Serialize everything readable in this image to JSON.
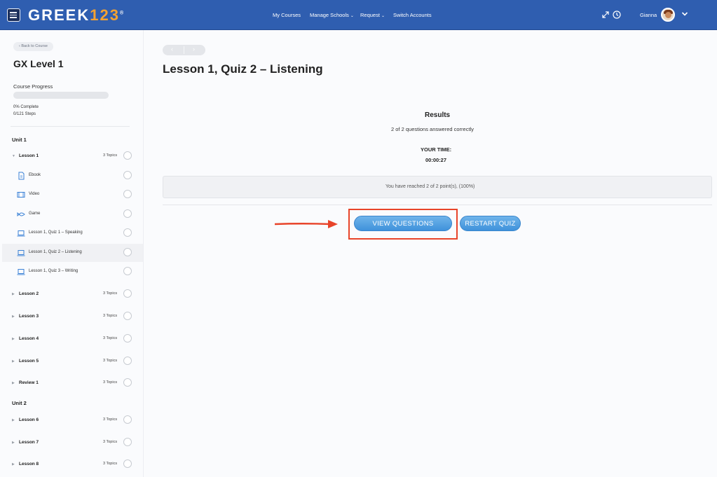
{
  "header": {
    "logo_main": "GREEK",
    "logo_accent": "123",
    "logo_reg": "®",
    "nav": {
      "my_courses": "My Courses",
      "manage_schools": "Manage Schools",
      "request": "Request",
      "switch_accounts": "Switch Accounts"
    },
    "user_name": "Gianna",
    "icons": [
      "menu-icon",
      "expand-icon",
      "clock-icon",
      "chevron-down-icon"
    ],
    "brand_color": "#2f5eb0",
    "accent_color": "#f3a232"
  },
  "sidebar": {
    "back_label": "‹  Back to Course",
    "course_title": "GX Level 1",
    "progress_label": "Course Progress",
    "progress_fraction": 0,
    "progress_pct_text": "0% Complete",
    "progress_steps_text": "0/121 Steps",
    "units": [
      {
        "label": "Unit 1",
        "lessons": [
          {
            "label": "Lesson 1",
            "topics": "3 Topics",
            "expanded": true,
            "items": [
              {
                "label": "Ebook",
                "icon": "ebook-icon"
              },
              {
                "label": "Video",
                "icon": "video-icon"
              },
              {
                "label": "Game",
                "icon": "game-icon"
              },
              {
                "label": "Lesson 1, Quiz 1 – Speaking",
                "icon": "laptop-icon"
              },
              {
                "label": "Lesson 1, Quiz 2 – Listening",
                "icon": "laptop-icon",
                "active": true
              },
              {
                "label": "Lesson 1, Quiz 3 – Writing",
                "icon": "laptop-icon"
              }
            ]
          },
          {
            "label": "Lesson 2",
            "topics": "3 Topics"
          },
          {
            "label": "Lesson 3",
            "topics": "3 Topics"
          },
          {
            "label": "Lesson 4",
            "topics": "3 Topics"
          },
          {
            "label": "Lesson 5",
            "topics": "3 Topics"
          },
          {
            "label": "Review 1",
            "topics": "3 Topics"
          }
        ]
      },
      {
        "label": "Unit 2",
        "lessons": [
          {
            "label": "Lesson 6",
            "topics": "3 Topics"
          },
          {
            "label": "Lesson 7",
            "topics": "3 Topics"
          },
          {
            "label": "Lesson 8",
            "topics": "3 Topics"
          }
        ]
      }
    ]
  },
  "main": {
    "pager_prev": "‹",
    "pager_next": "›",
    "page_title": "Lesson 1, Quiz 2 – Listening",
    "results_title": "Results",
    "results_sub": "2 of 2 questions answered correctly",
    "time_label": "YOUR TIME:",
    "time_value": "00:00:27",
    "points_text": "You have reached 2 of 2 point(s), (100%)",
    "view_questions_label": "VIEW QUESTIONS",
    "restart_quiz_label": "RESTART QUIZ",
    "button_color": "#3f92db",
    "highlight_color": "#e8442a"
  }
}
